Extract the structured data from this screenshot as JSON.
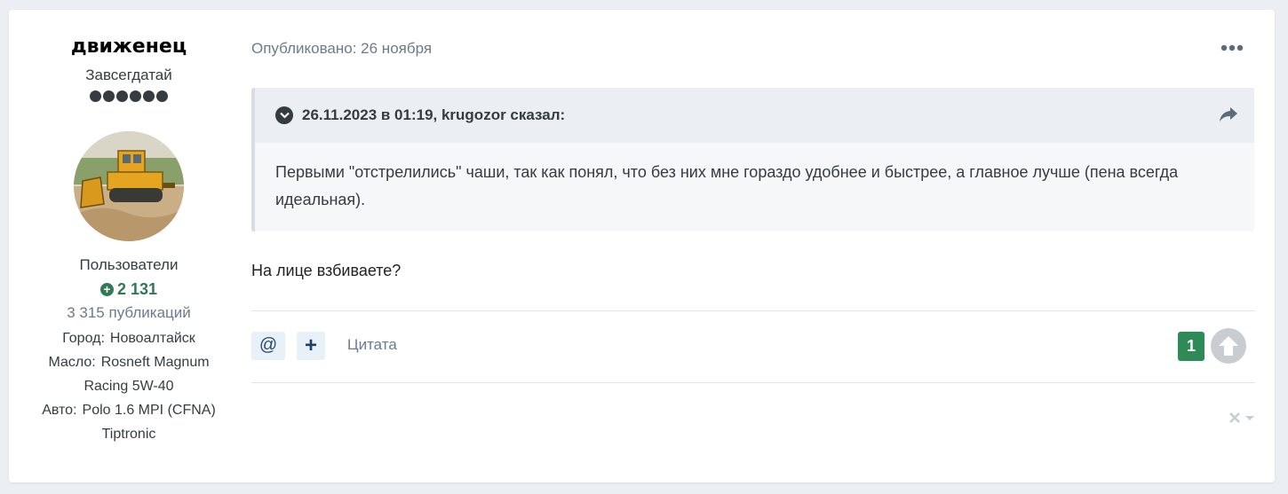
{
  "author": {
    "name": "движенец",
    "title": "Завсегдатай",
    "pips": 6,
    "group": "Пользователи",
    "reputation": "2 131",
    "posts": "3 315 публикаций",
    "fields": [
      {
        "label": "Город:",
        "value": "Новоалтайск"
      },
      {
        "label": "Масло:",
        "value": "Rosneft Magnum Racing 5W-40"
      },
      {
        "label": "Авто:",
        "value": "Polo 1.6 MPI (CFNA) Tiptronic"
      }
    ]
  },
  "post": {
    "published": "Опубликовано: 26 ноября",
    "quote": {
      "citation": "26.11.2023 в 01:19, krugozor сказал:",
      "text": "Первыми \"отстрелились\" чаши, так как понял, что без них мне гораздо удобнее и быстрее, а главное лучше (пена всегда идеальная)."
    },
    "reply": "На лице взбиваете?"
  },
  "actions": {
    "mention": "@",
    "add": "+",
    "quote_label": "Цитата",
    "vote_count": "1"
  },
  "icons": [
    "menu-dots-icon",
    "chevron-down-icon",
    "share-icon",
    "plus-circle-icon",
    "arrow-up-icon",
    "close-icon"
  ],
  "colors": {
    "reputation": "#2e7a56",
    "vote": "#2e8b57",
    "accent": "#2b4a6f"
  }
}
